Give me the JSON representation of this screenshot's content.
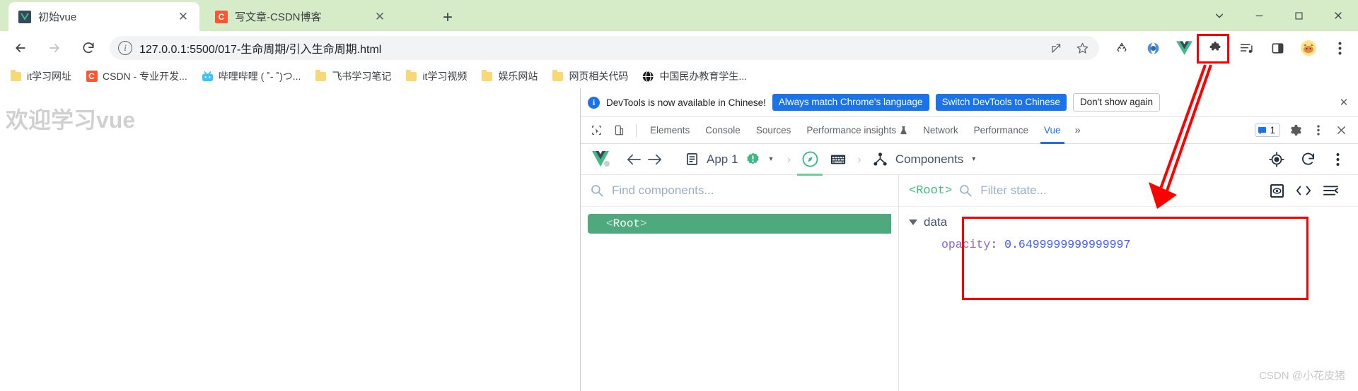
{
  "browser": {
    "tabs": [
      {
        "title": "初始vue",
        "favicon": "vue-icon",
        "active": true,
        "close_label": "✕"
      },
      {
        "title": "写文章-CSDN博客",
        "favicon": "csdn-icon",
        "favicon_text": "C",
        "active": false,
        "close_label": "✕"
      }
    ],
    "new_tab_label": "+",
    "window_controls": {
      "minimize": "─",
      "maximize": "▢",
      "close": "✕",
      "tab_search": "⌄"
    },
    "nav": {
      "back": "back-arrow",
      "forward": "forward-arrow",
      "reload": "reload-icon"
    },
    "omnibox": {
      "url": "127.0.0.1:5500/017-生命周期/引入生命周期.html",
      "info_icon": "info-icon",
      "share_icon": "share-icon",
      "bookmark_icon": "star-icon"
    },
    "extensions": [
      {
        "name": "recycle-extension-icon"
      },
      {
        "name": "eyedropper-extension-icon"
      },
      {
        "name": "vue-devtools-extension-icon",
        "highlighted": true
      },
      {
        "name": "puzzle-extensions-icon"
      },
      {
        "name": "reading-list-icon"
      },
      {
        "name": "side-panel-icon"
      },
      {
        "name": "profile-avatar"
      },
      {
        "name": "chrome-menu-icon"
      }
    ],
    "bookmarks": [
      {
        "label": "it学习网址",
        "icon": "folder-icon"
      },
      {
        "label": "CSDN - 专业开发...",
        "icon": "csdn-icon"
      },
      {
        "label": "哔哩哔哩 ( ˚- ˚)つ...",
        "icon": "bilibili-icon"
      },
      {
        "label": "飞书学习笔记",
        "icon": "folder-icon"
      },
      {
        "label": "it学习视频",
        "icon": "folder-icon"
      },
      {
        "label": "娱乐网站",
        "icon": "folder-icon"
      },
      {
        "label": "网页相关代码",
        "icon": "folder-icon"
      },
      {
        "label": "中国民办教育学生...",
        "icon": "globe-icon"
      }
    ]
  },
  "page": {
    "heading": "欢迎学习vue"
  },
  "devtools": {
    "banner": {
      "icon": "info-icon",
      "message": "DevTools is now available in Chinese!",
      "primary_button": "Always match Chrome's language",
      "secondary_button": "Switch DevTools to Chinese",
      "tertiary_button": "Don't show again",
      "close_label": "✕"
    },
    "tabs": [
      {
        "label": "Elements",
        "selected": false
      },
      {
        "label": "Console",
        "selected": false
      },
      {
        "label": "Sources",
        "selected": false
      },
      {
        "label": "Performance insights",
        "selected": false,
        "suffix_icon": "beaker-icon"
      },
      {
        "label": "Network",
        "selected": false
      },
      {
        "label": "Performance",
        "selected": false
      },
      {
        "label": "Vue",
        "selected": true
      }
    ],
    "more_tabs_label": "»",
    "issues_count": "1",
    "left_icons": [
      "inspect-icon",
      "device-toolbar-icon"
    ],
    "right_icons": [
      "settings-gear-icon",
      "devtools-menu-icon",
      "devtools-close-icon"
    ]
  },
  "vue": {
    "toolbar": {
      "logo": "vue-logo-icon",
      "back": "back-arrow-icon",
      "forward": "forward-arrow-icon",
      "app_icon": "app-document-icon",
      "app_label": "App 1",
      "app_badge": "warning-badge-icon",
      "app_caret": "▾",
      "instance_icon": "vue-instance-icon",
      "keyboard_icon": "keyboard-icon",
      "panel_icon": "components-tree-icon",
      "panel_label": "Components",
      "panel_caret": "▾",
      "target_icon": "select-target-icon",
      "refresh_icon": "refresh-icon",
      "menu_icon": "more-vertical-icon"
    },
    "components": {
      "search_placeholder": "Find components...",
      "search_icon": "search-icon",
      "tree": [
        {
          "open": "<",
          "name": "Root",
          "close": ">",
          "selected": true
        }
      ]
    },
    "state": {
      "selected_component": "<Root>",
      "filter_placeholder": "Filter state...",
      "filter_icon": "search-icon",
      "toolbar_icons": [
        "inspect-dom-icon",
        "open-in-editor-icon",
        "collapse-all-icon"
      ],
      "groups": [
        {
          "name": "data",
          "expanded": true,
          "caret": "▾",
          "props": [
            {
              "key": "opacity",
              "separator": ":",
              "value": "0.6499999999999997"
            }
          ]
        }
      ]
    }
  },
  "annotations": {
    "watermark": "CSDN @小花皮猪",
    "highlight_color": "#ff0000"
  }
}
